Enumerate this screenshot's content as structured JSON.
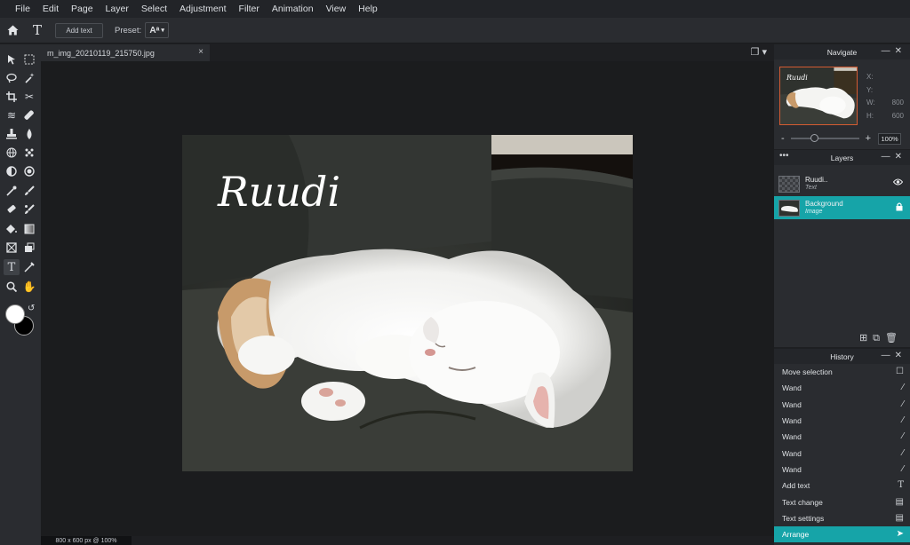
{
  "menu": [
    "File",
    "Edit",
    "Page",
    "Layer",
    "Select",
    "Adjustment",
    "Filter",
    "Animation",
    "View",
    "Help"
  ],
  "options": {
    "add_text": "Add text",
    "preset_label": "Preset:",
    "preset_value": "Aᵃ"
  },
  "document": {
    "tab_name": "m_img_20210119_215750.jpg",
    "close": "×",
    "status": "800 x 600 px @ 100%",
    "watermark_text": "Ruudi"
  },
  "navigate": {
    "title": "Navigate",
    "x_label": "X:",
    "y_label": "Y:",
    "w_label": "W:",
    "w_value": "800",
    "h_label": "H:",
    "h_value": "600",
    "zoom": "100%"
  },
  "layers": {
    "title": "Layers",
    "items": [
      {
        "name": "Ruudi..",
        "type": "Text",
        "icon": "eye-icon",
        "selected": false
      },
      {
        "name": "Background",
        "type": "Image",
        "icon": "lock-icon",
        "selected": true
      }
    ]
  },
  "history": {
    "title": "History",
    "items": [
      {
        "label": "Move selection",
        "icon": "selection-icon"
      },
      {
        "label": "Wand",
        "icon": "wand-icon"
      },
      {
        "label": "Wand",
        "icon": "wand-icon"
      },
      {
        "label": "Wand",
        "icon": "wand-icon"
      },
      {
        "label": "Wand",
        "icon": "wand-icon"
      },
      {
        "label": "Wand",
        "icon": "wand-icon"
      },
      {
        "label": "Wand",
        "icon": "wand-icon"
      },
      {
        "label": "Add text",
        "icon": "text-icon"
      },
      {
        "label": "Text change",
        "icon": "document-icon"
      },
      {
        "label": "Text settings",
        "icon": "document-icon"
      },
      {
        "label": "Arrange",
        "icon": "pointer-icon"
      }
    ]
  },
  "colors": {
    "accent": "#16a4a8",
    "foreground": "#ffffff",
    "background": "#000000"
  }
}
